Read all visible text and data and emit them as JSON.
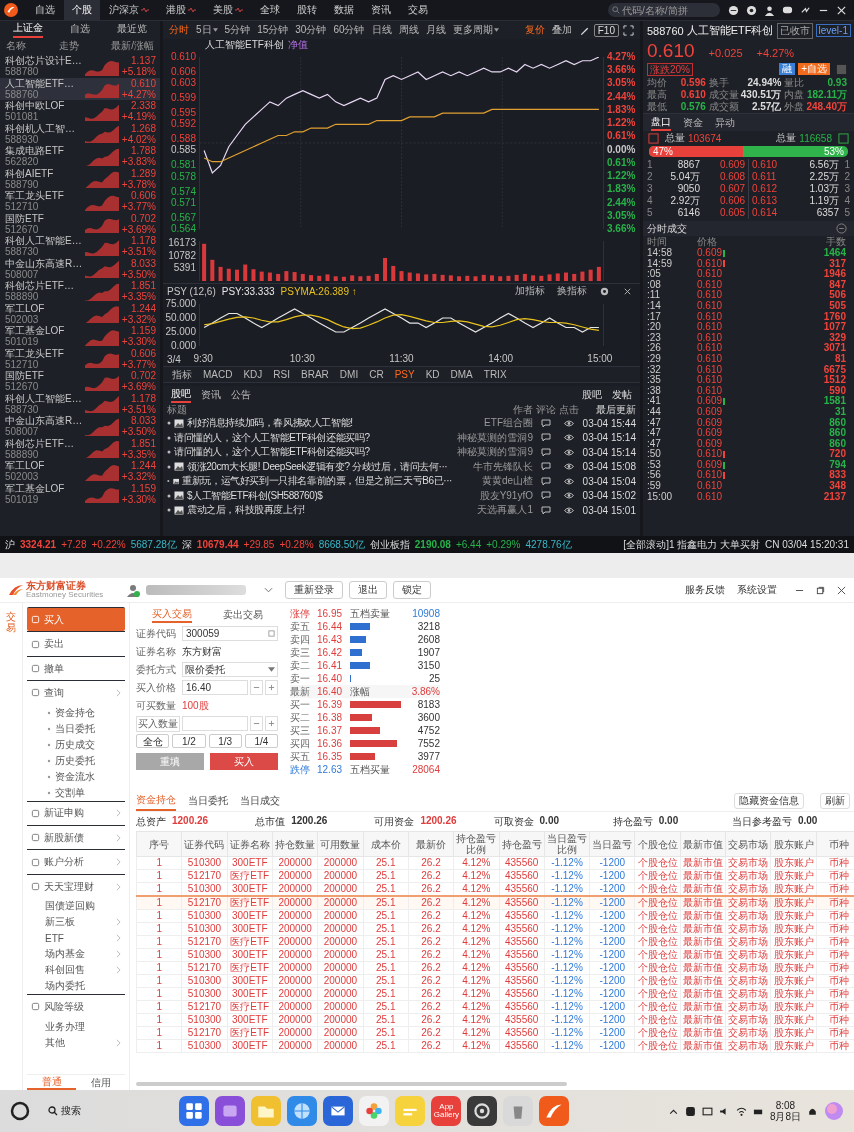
{
  "top_nav": {
    "tabs": [
      {
        "label": "自选",
        "selected": false,
        "live": false
      },
      {
        "label": "个股",
        "selected": true,
        "live": false
      },
      {
        "label": "沪深京",
        "selected": false,
        "live": true
      },
      {
        "label": "港股",
        "selected": false,
        "live": true
      },
      {
        "label": "美股",
        "selected": false,
        "live": true
      },
      {
        "label": "全球",
        "selected": false,
        "live": false
      },
      {
        "label": "股转",
        "selected": false,
        "live": false
      },
      {
        "label": "数据",
        "selected": false,
        "live": false
      },
      {
        "label": "资讯",
        "selected": false,
        "live": false
      },
      {
        "label": "交易",
        "selected": false,
        "live": false
      }
    ],
    "search": {
      "placeholder": "代码/名称/简拼"
    }
  },
  "watchlist": {
    "tabs": [
      {
        "label": "上证金",
        "selected": true
      },
      {
        "label": "自选",
        "selected": false
      },
      {
        "label": "最近览",
        "selected": false
      }
    ],
    "columns": [
      "名称",
      "走势",
      "最新/涨幅"
    ],
    "rows": [
      {
        "name": "科创芯片设计E…",
        "code": "588780",
        "price": "1.137",
        "change": "+5.18%",
        "selected": false
      },
      {
        "name": "人工智能ETF…",
        "code": "588760",
        "price": "0.610",
        "change": "+4.27%",
        "selected": true
      },
      {
        "name": "科创中欧LOF",
        "code": "501081",
        "price": "2.338",
        "change": "+4.19%",
        "selected": false
      },
      {
        "name": "科创机人工智…",
        "code": "588930",
        "price": "1.268",
        "change": "+4.02%",
        "selected": false
      },
      {
        "name": "集成电路ETF",
        "code": "562820",
        "price": "1.788",
        "change": "+3.83%",
        "selected": false
      },
      {
        "name": "科创AIETF",
        "code": "588790",
        "price": "1.289",
        "change": "+3.78%",
        "selected": false
      },
      {
        "name": "军工龙头ETF",
        "code": "512710",
        "price": "0.606",
        "change": "+3.77%",
        "selected": false
      },
      {
        "name": "国防ETF",
        "code": "512670",
        "price": "0.702",
        "change": "+3.69%",
        "selected": false
      },
      {
        "name": "科创人工智能E…",
        "code": "588730",
        "price": "1.178",
        "change": "+3.51%",
        "selected": false
      },
      {
        "name": "中金山东高速R…",
        "code": "508007",
        "price": "8.033",
        "change": "+3.50%",
        "selected": false
      },
      {
        "name": "科创芯片ETF…",
        "code": "588890",
        "price": "1.851",
        "change": "+3.35%",
        "selected": false
      },
      {
        "name": "军工LOF",
        "code": "502003",
        "price": "1.244",
        "change": "+3.32%",
        "selected": false
      },
      {
        "name": "军工基金LOF",
        "code": "501019",
        "price": "1.159",
        "change": "+3.30%",
        "selected": false
      },
      {
        "name": "军工龙头ETF",
        "code": "512710",
        "price": "0.606",
        "change": "+3.77%",
        "selected": false
      },
      {
        "name": "国防ETF",
        "code": "512670",
        "price": "0.702",
        "change": "+3.69%",
        "selected": false
      },
      {
        "name": "科创人工智能E…",
        "code": "588730",
        "price": "1.178",
        "change": "+3.51%",
        "selected": false
      },
      {
        "name": "中金山东高速R…",
        "code": "508007",
        "price": "8.033",
        "change": "+3.50%",
        "selected": false
      },
      {
        "name": "科创芯片ETF…",
        "code": "588890",
        "price": "1.851",
        "change": "+3.35%",
        "selected": false
      },
      {
        "name": "军工LOF",
        "code": "502003",
        "price": "1.244",
        "change": "+3.32%",
        "selected": false
      },
      {
        "name": "军工基金LOF",
        "code": "501019",
        "price": "1.159",
        "change": "+3.30%",
        "selected": false
      }
    ]
  },
  "chart_panel": {
    "periods": [
      {
        "label": "分时",
        "selected": true,
        "menu": false
      },
      {
        "label": "5日",
        "selected": false,
        "menu": true
      },
      {
        "label": "5分钟",
        "selected": false,
        "menu": false
      },
      {
        "label": "15分钟",
        "selected": false,
        "menu": false
      },
      {
        "label": "30分钟",
        "selected": false,
        "menu": false
      },
      {
        "label": "60分钟",
        "selected": false,
        "menu": false
      },
      {
        "label": "日线",
        "selected": false,
        "menu": false
      },
      {
        "label": "周线",
        "selected": false,
        "menu": false
      },
      {
        "label": "月线",
        "selected": false,
        "menu": false
      },
      {
        "label": "更多周期",
        "selected": false,
        "menu": true
      }
    ],
    "price_mode": "复价",
    "overlay": "叠加",
    "f10": "F10",
    "nav_tag": "净值",
    "pct_axis": [
      {
        "text": "4.27%",
        "color": "#f0433b"
      },
      {
        "text": "3.66%",
        "color": "#f0433b"
      },
      {
        "text": "3.05%",
        "color": "#f0433b"
      },
      {
        "text": "2.44%",
        "color": "#f0433b"
      },
      {
        "text": "1.83%",
        "color": "#f0433b"
      },
      {
        "text": "1.22%",
        "color": "#f0433b"
      },
      {
        "text": "0.61%",
        "color": "#f0433b"
      },
      {
        "text": "0.00%",
        "color": "#c8c8c8"
      },
      {
        "text": "0.61%",
        "color": "#27b34a"
      },
      {
        "text": "1.22%",
        "color": "#27b34a"
      },
      {
        "text": "1.83%",
        "color": "#27b34a"
      },
      {
        "text": "2.44%",
        "color": "#27b34a"
      },
      {
        "text": "3.05%",
        "color": "#27b34a"
      },
      {
        "text": "3.66%",
        "color": "#27b34a"
      }
    ],
    "chart_data": {
      "type": "line",
      "title": "人工智能ETF科创",
      "grid": true,
      "categories": [
        null,
        null,
        null,
        null,
        null,
        null,
        null,
        null,
        null,
        null,
        null,
        null,
        null,
        null,
        null,
        null,
        null,
        null,
        null,
        null,
        null,
        null,
        null,
        null,
        null,
        null,
        null,
        null,
        null,
        null,
        null,
        null,
        null,
        null,
        null,
        null,
        null,
        null,
        null,
        null,
        null,
        null,
        null,
        null,
        null,
        null,
        null,
        null,
        null
      ],
      "ylim": [
        0.564,
        0.61
      ],
      "yticks": [
        {
          "value": 0.61,
          "label": "0.610"
        },
        {
          "value": 0.606,
          "label": "0.606"
        },
        {
          "value": 0.603,
          "label": "0.603"
        },
        {
          "value": 0.599,
          "label": "0.599"
        },
        {
          "value": 0.595,
          "label": "0.595"
        },
        {
          "value": 0.592,
          "label": "0.592"
        },
        {
          "value": 0.588,
          "label": "0.588"
        },
        {
          "value": 0.585,
          "label": "0.585"
        },
        {
          "value": 0.581,
          "label": "0.581"
        },
        {
          "value": 0.578,
          "label": "0.578"
        },
        {
          "value": 0.574,
          "label": "0.574"
        },
        {
          "value": 0.571,
          "label": "0.571"
        },
        {
          "value": 0.567,
          "label": "0.567"
        },
        {
          "value": 0.564,
          "label": "0.564"
        }
      ],
      "series": [
        {
          "color": "#e8d8f4",
          "values": [
            0.585,
            0.579,
            0.581,
            0.586,
            0.589,
            0.592,
            0.594,
            0.596,
            0.598,
            0.597,
            0.599,
            0.6,
            0.601,
            0.6,
            0.599,
            0.6,
            0.598,
            0.597,
            0.598,
            0.599,
            0.598,
            0.599,
            0.604,
            0.605,
            0.604,
            0.605,
            0.606,
            0.604,
            0.605,
            0.606,
            0.605,
            0.606,
            0.605,
            0.606,
            0.607,
            0.606,
            0.606,
            0.607,
            0.606,
            0.608,
            0.607,
            0.608,
            0.607,
            0.608,
            0.609,
            0.608,
            0.609,
            0.609,
            0.61
          ]
        },
        {
          "color": "#e0a030",
          "values": [
            0.583,
            0.582,
            0.582,
            0.583,
            0.584,
            0.585,
            0.586,
            0.587,
            0.588,
            0.589,
            0.589,
            0.59,
            0.59,
            0.591,
            0.591,
            0.591,
            0.592,
            0.592,
            0.592,
            0.592,
            0.592,
            0.593,
            0.593,
            0.593,
            0.593,
            0.594,
            0.594,
            0.594,
            0.594,
            0.595,
            0.595,
            0.595,
            0.595,
            0.595,
            0.595,
            0.596,
            0.596,
            0.596,
            0.596,
            0.596,
            0.596,
            0.596,
            0.596,
            0.596,
            0.596,
            0.596,
            0.596,
            0.596,
            0.596
          ]
        }
      ]
    },
    "volume": {
      "chart_data": {
        "type": "bar",
        "categories": [
          null,
          null,
          null,
          null,
          null,
          null,
          null,
          null,
          null,
          null,
          null,
          null,
          null,
          null,
          null,
          null,
          null,
          null,
          null,
          null,
          null,
          null,
          null,
          null,
          null,
          null,
          null,
          null,
          null,
          null,
          null,
          null,
          null,
          null,
          null,
          null,
          null,
          null,
          null,
          null,
          null,
          null,
          null,
          null,
          null,
          null,
          null,
          null,
          null
        ],
        "ylim": [
          0,
          17000
        ],
        "yticks": [
          16173,
          10782,
          5391
        ],
        "series": [
          {
            "color": "#d9393a",
            "values": [
              15800,
              9000,
              6000,
              5200,
              4800,
              7000,
              5000,
              4000,
              3600,
              3000,
              4200,
              3800,
              3000,
              2500,
              2200,
              2800,
              2000,
              1800,
              2400,
              2000,
              2200,
              3000,
              9800,
              6400,
              4200,
              3600,
              3200,
              2800,
              3000,
              2600,
              2400,
              2000,
              2200,
              2000,
              2600,
              2400,
              2000,
              2200,
              2600,
              3000,
              2400,
              2200,
              2800,
              3200,
              3600,
              3000,
              4000,
              4800,
              6000
            ]
          }
        ]
      }
    },
    "indicator": {
      "name": "PSY (12,6)",
      "readouts": [
        {
          "text": "PSY:33.333",
          "color": "#e6e6e6"
        },
        {
          "text": "PSYMA:26.389 ↑",
          "color": "#e8c21e"
        }
      ],
      "buttons": [
        "加指标",
        "换指标"
      ],
      "chart_data": {
        "type": "line",
        "ylim": [
          0,
          75
        ],
        "yticks": [
          {
            "value": 75,
            "label": "75.000"
          },
          {
            "value": 50,
            "label": "50.000"
          },
          {
            "value": 25,
            "label": "25.000"
          },
          {
            "value": 0,
            "label": "0.000"
          }
        ],
        "categories": [
          "9:30",
          null,
          null,
          null,
          null,
          null,
          null,
          null,
          null,
          null,
          null,
          null,
          "10:30",
          null,
          null,
          null,
          null,
          null,
          null,
          null,
          null,
          null,
          null,
          null,
          "11:30",
          null,
          null,
          null,
          null,
          null,
          null,
          null,
          null,
          null,
          null,
          null,
          "14:00",
          null,
          null,
          null,
          null,
          null,
          null,
          null,
          null,
          null,
          null,
          null,
          "15:00"
        ],
        "series": [
          {
            "color": "#e6e6e6",
            "values": [
              33,
              41,
              50,
              58,
              58,
              50,
              41,
              33,
              41,
              50,
              58,
              66,
              58,
              50,
              41,
              33,
              25,
              25,
              33,
              41,
              50,
              58,
              66,
              58,
              50,
              41,
              41,
              33,
              41,
              50,
              50,
              41,
              33,
              25,
              33,
              41,
              50,
              58,
              50,
              41,
              33,
              41,
              50,
              41,
              33,
              33,
              25,
              33,
              33
            ]
          },
          {
            "color": "#e8c21e",
            "values": [
              38,
              40,
              44,
              48,
              51,
              52,
              50,
              46,
              43,
              43,
              47,
              52,
              55,
              55,
              52,
              47,
              40,
              34,
              31,
              32,
              37,
              43,
              50,
              55,
              56,
              53,
              49,
              45,
              42,
              42,
              44,
              45,
              43,
              39,
              35,
              34,
              37,
              42,
              47,
              49,
              47,
              44,
              42,
              42,
              41,
              38,
              34,
              30,
              28
            ]
          }
        ]
      }
    },
    "date_label": "3/4",
    "indicator_tabs": [
      {
        "label": "指标",
        "selected": false
      },
      {
        "label": "MACD",
        "selected": false
      },
      {
        "label": "KDJ",
        "selected": false
      },
      {
        "label": "RSI",
        "selected": false
      },
      {
        "label": "BRAR",
        "selected": false
      },
      {
        "label": "DMI",
        "selected": false
      },
      {
        "label": "CR",
        "selected": false
      },
      {
        "label": "PSY",
        "selected": true
      },
      {
        "label": "KD",
        "selected": false
      },
      {
        "label": "DMA",
        "selected": false
      },
      {
        "label": "TRIX",
        "selected": false
      }
    ]
  },
  "news": {
    "tabs": [
      {
        "label": "股吧",
        "selected": true
      },
      {
        "label": "资讯",
        "selected": false
      },
      {
        "label": "公告",
        "selected": false
      }
    ],
    "actions": [
      "股吧",
      "发帖"
    ],
    "columns": [
      "标题",
      "作者",
      "评论",
      "点击",
      "最后更新"
    ],
    "rows": [
      {
        "title": "利好消息持续加码，春风拂欢人工智能!",
        "author": "ETF组合圈",
        "time": "03-04 15:44",
        "has_image": true
      },
      {
        "title": "请问懂的人，这个人工智能ETF科创还能买吗?",
        "author": "神秘莫测的雪洞9",
        "time": "03-04 15:14",
        "has_image": false
      },
      {
        "title": "请问懂的人，这个人工智能ETF科创还能买吗?",
        "author": "神秘莫测的雪洞9",
        "time": "03-04 15:14",
        "has_image": false
      },
      {
        "title": "领涨20cm大长腿! DeepSeek逻辑有变? 分歧过后，请问去何···",
        "author": "牛市先锋队长",
        "time": "03-04 15:08",
        "has_image": true
      },
      {
        "title": "重新玩，运气好买到一只排名靠前的票，但是之前三天亏B6已···",
        "author": "黄黄de山楂",
        "time": "03-04 15:04",
        "has_image": true
      },
      {
        "title": "$人工智能ETF科创(SH588760)$",
        "author": "股友Y91yfO",
        "time": "03-04 15:02",
        "has_image": true
      },
      {
        "title": "震动之后，科技股再度上行!",
        "author": "天选再赢人1",
        "time": "03-04 15:01",
        "has_image": true
      }
    ]
  },
  "quote": {
    "code": "588760",
    "name": "人工智能ETF科创",
    "status": "已收市",
    "level": "level-1",
    "price": "0.610",
    "change": "+0.025",
    "pct": "+4.27%",
    "limit_tag": "涨跌20%",
    "tags": [
      {
        "label": "融",
        "color": "#3a7fd5"
      },
      {
        "label": "+自选",
        "color": "#f26b1d"
      }
    ],
    "stats": [
      {
        "label": "均价",
        "value": "0.596",
        "color": "#f0433b"
      },
      {
        "label": "换手",
        "value": "24.94%",
        "color": "#dddddd"
      },
      {
        "label": "量比",
        "value": "0.93",
        "color": "#27b34a"
      },
      {
        "label": "最高",
        "value": "0.610",
        "color": "#f0433b"
      },
      {
        "label": "成交量",
        "value": "430.51万",
        "color": "#dddddd"
      },
      {
        "label": "内盘",
        "value": "182.11万",
        "color": "#27b34a"
      },
      {
        "label": "最低",
        "value": "0.576",
        "color": "#27b34a"
      },
      {
        "label": "成交额",
        "value": "2.57亿",
        "color": "#dddddd"
      },
      {
        "label": "外盘",
        "value": "248.40万",
        "color": "#f0433b"
      }
    ],
    "tabs": [
      {
        "label": "盘口",
        "selected": true
      },
      {
        "label": "资金",
        "selected": false
      },
      {
        "label": "异动",
        "selected": false
      }
    ],
    "bid_total": {
      "label": "总量",
      "value": "103674"
    },
    "ask_total": {
      "label": "总量",
      "value": "116658"
    },
    "ratio": {
      "buy_text": "47%",
      "sell_text": "53%",
      "level": 0.47
    },
    "book": [
      {
        "bid_level": "1",
        "bid_vol": "8867",
        "bid_price": "0.609",
        "ask_price": "0.610",
        "ask_vol": "6.56万",
        "ask_level": "1"
      },
      {
        "bid_level": "2",
        "bid_vol": "5.04万",
        "bid_price": "0.608",
        "ask_price": "0.611",
        "ask_vol": "2.25万",
        "ask_level": "2"
      },
      {
        "bid_level": "3",
        "bid_vol": "9050",
        "bid_price": "0.607",
        "ask_price": "0.612",
        "ask_vol": "1.03万",
        "ask_level": "3"
      },
      {
        "bid_level": "4",
        "bid_vol": "2.92万",
        "bid_price": "0.606",
        "ask_price": "0.613",
        "ask_vol": "1.19万",
        "ask_level": "4"
      },
      {
        "bid_level": "5",
        "bid_vol": "6146",
        "bid_price": "0.605",
        "ask_price": "0.614",
        "ask_vol": "6357",
        "ask_level": "5"
      }
    ],
    "trades_title": "分时成交",
    "trade_columns": [
      "时间",
      "价格",
      "手数"
    ],
    "trades": [
      {
        "time": "14:58",
        "price": "0.609",
        "volume": "1464",
        "color": "#27b34a",
        "marker": true
      },
      {
        "time": "14:59",
        "price": "0.610",
        "volume": "317",
        "color": "#f0433b",
        "marker": true
      },
      {
        "time": ":05",
        "price": "0.610",
        "volume": "1946",
        "color": "#f0433b",
        "marker": false
      },
      {
        "time": ":08",
        "price": "0.610",
        "volume": "847",
        "color": "#f0433b",
        "marker": false
      },
      {
        "time": ":11",
        "price": "0.610",
        "volume": "506",
        "color": "#f0433b",
        "marker": false
      },
      {
        "time": ":14",
        "price": "0.610",
        "volume": "505",
        "color": "#f0433b",
        "marker": false
      },
      {
        "time": ":17",
        "price": "0.610",
        "volume": "1760",
        "color": "#f0433b",
        "marker": false
      },
      {
        "time": ":20",
        "price": "0.610",
        "volume": "1077",
        "color": "#f0433b",
        "marker": false
      },
      {
        "time": ":23",
        "price": "0.610",
        "volume": "329",
        "color": "#f0433b",
        "marker": false
      },
      {
        "time": ":26",
        "price": "0.610",
        "volume": "3071",
        "color": "#f0433b",
        "marker": false
      },
      {
        "time": ":29",
        "price": "0.610",
        "volume": "81",
        "color": "#f0433b",
        "marker": false
      },
      {
        "time": ":32",
        "price": "0.610",
        "volume": "6675",
        "color": "#f0433b",
        "marker": false
      },
      {
        "time": ":35",
        "price": "0.610",
        "volume": "1512",
        "color": "#f0433b",
        "marker": false
      },
      {
        "time": ":38",
        "price": "0.610",
        "volume": "590",
        "color": "#f0433b",
        "marker": false
      },
      {
        "time": ":41",
        "price": "0.609",
        "volume": "1581",
        "color": "#27b34a",
        "marker": true
      },
      {
        "time": ":44",
        "price": "0.609",
        "volume": "31",
        "color": "#27b34a",
        "marker": false
      },
      {
        "time": ":47",
        "price": "0.609",
        "volume": "860",
        "color": "#27b34a",
        "marker": false
      },
      {
        "time": ":47",
        "price": "0.609",
        "volume": "860",
        "color": "#27b34a",
        "marker": false
      },
      {
        "time": ":47",
        "price": "0.609",
        "volume": "860",
        "color": "#27b34a",
        "marker": false
      },
      {
        "time": ":50",
        "price": "0.610",
        "volume": "720",
        "color": "#f0433b",
        "marker": true
      },
      {
        "time": ":53",
        "price": "0.609",
        "volume": "794",
        "color": "#27b34a",
        "marker": true
      },
      {
        "time": ":56",
        "price": "0.610",
        "volume": "833",
        "color": "#f0433b",
        "marker": true
      },
      {
        "time": ":59",
        "price": "0.610",
        "volume": "348",
        "color": "#f0433b",
        "marker": false
      },
      {
        "time": "15:00",
        "price": "0.610",
        "volume": "2137",
        "color": "#f0433b",
        "marker": false
      }
    ]
  },
  "status_bar": {
    "indices": [
      {
        "market": "沪",
        "value": "3324.21",
        "change": "+7.28",
        "pct": "+0.22%",
        "turnover": "5687.28亿",
        "color": "#f0433b"
      },
      {
        "market": "深",
        "value": "10679.44",
        "change": "+29.85",
        "pct": "+0.28%",
        "turnover": "8668.50亿",
        "color": "#f0433b"
      },
      {
        "market": "创业板指",
        "value": "2190.08",
        "change": "+6.44",
        "pct": "+0.29%",
        "turnover": "4278.76亿",
        "color": "#27b34a"
      }
    ],
    "ticker": "[全部滚动]1 指鑫电力 大单买射",
    "clock": "CN 03/04 15:20:31"
  },
  "trading": {
    "brand": "东方财富证券",
    "brand_en": "Eastmoney Securities",
    "header_buttons": [
      "重新登录",
      "退出",
      "锁定"
    ],
    "header_links": [
      "服务反馈",
      "系统设置"
    ],
    "side_tab": "交易",
    "menu": [
      {
        "label": "买入",
        "kind": "main",
        "selected": true,
        "expandable": false
      },
      {
        "label": "卖出",
        "kind": "main",
        "selected": false,
        "expandable": false
      },
      {
        "label": "撤单",
        "kind": "main",
        "selected": false,
        "expandable": false
      },
      {
        "label": "查询",
        "kind": "main",
        "selected": false,
        "expandable": true
      },
      {
        "label": "资金持仓",
        "kind": "sub",
        "selected": false,
        "expandable": false
      },
      {
        "label": "当日委托",
        "kind": "sub",
        "selected": false,
        "expandable": false
      },
      {
        "label": "历史成交",
        "kind": "sub",
        "selected": false,
        "expandable": false
      },
      {
        "label": "历史委托",
        "kind": "sub",
        "selected": false,
        "expandable": false
      },
      {
        "label": "资金流水",
        "kind": "sub",
        "selected": false,
        "expandable": false
      },
      {
        "label": "交割单",
        "kind": "sub",
        "selected": false,
        "expandable": false
      },
      {
        "label": "新证申购",
        "kind": "main",
        "selected": false,
        "expandable": true
      },
      {
        "label": "新股新债",
        "kind": "main",
        "selected": false,
        "expandable": true
      },
      {
        "label": "账户分析",
        "kind": "main",
        "selected": false,
        "expandable": true
      },
      {
        "label": "天天宝理财",
        "kind": "main",
        "selected": false,
        "expandable": true
      },
      {
        "label": "国债逆回购",
        "kind": "plain",
        "selected": false,
        "expandable": false
      },
      {
        "label": "新三板",
        "kind": "plain",
        "selected": false,
        "expandable": true
      },
      {
        "label": "ETF",
        "kind": "plain",
        "selected": false,
        "expandable": true
      },
      {
        "label": "场内基金",
        "kind": "plain",
        "selected": false,
        "expandable": true
      },
      {
        "label": "科创回售",
        "kind": "plain",
        "selected": false,
        "expandable": true
      },
      {
        "label": "场内委托",
        "kind": "plain",
        "selected": false,
        "expandable": false
      },
      {
        "label": "风险等级",
        "kind": "main",
        "selected": false,
        "expandable": false
      },
      {
        "label": "业务办理",
        "kind": "plain",
        "selected": false,
        "expandable": false
      },
      {
        "label": "其他",
        "kind": "plain",
        "selected": false,
        "expandable": true
      }
    ],
    "account_tabs": [
      {
        "label": "普通",
        "selected": true
      },
      {
        "label": "信用",
        "selected": false
      }
    ],
    "form": {
      "tabs": [
        {
          "label": "买入交易",
          "selected": true
        },
        {
          "label": "卖出交易",
          "selected": false
        }
      ],
      "code_label": "证券代码",
      "code": "300059",
      "name_label": "证券名称",
      "name": "东方财富",
      "type_label": "委托方式",
      "order_type": "限价委托",
      "price_label": "买入价格",
      "price": "16.40",
      "avail_label": "可买数量",
      "available": "100股",
      "qty_label": "买入数量",
      "quick": [
        "全仓",
        "1/2",
        "1/3",
        "1/4"
      ],
      "reset": "重填",
      "submit": "买入"
    },
    "book": [
      {
        "label": "涨停",
        "price": "16.95",
        "note": "五档卖量",
        "volume": "10908",
        "kind": "limit_up"
      },
      {
        "label": "卖五",
        "price": "16.44",
        "volume": "3218",
        "kind": "ask"
      },
      {
        "label": "卖四",
        "price": "16.43",
        "volume": "2608",
        "kind": "ask"
      },
      {
        "label": "卖三",
        "price": "16.42",
        "volume": "1907",
        "kind": "ask"
      },
      {
        "label": "卖二",
        "price": "16.41",
        "volume": "3150",
        "kind": "ask"
      },
      {
        "label": "卖一",
        "price": "16.40",
        "volume": "25",
        "kind": "ask"
      },
      {
        "label": "最新",
        "price": "16.40",
        "note": "涨幅",
        "volume": "3.86%",
        "kind": "last"
      },
      {
        "label": "买一",
        "price": "16.39",
        "volume": "8183",
        "kind": "bid"
      },
      {
        "label": "买二",
        "price": "16.38",
        "volume": "3600",
        "kind": "bid"
      },
      {
        "label": "买三",
        "price": "16.37",
        "volume": "4752",
        "kind": "bid"
      },
      {
        "label": "买四",
        "price": "16.36",
        "volume": "7552",
        "kind": "bid"
      },
      {
        "label": "买五",
        "price": "16.35",
        "volume": "3977",
        "kind": "bid"
      },
      {
        "label": "跌停",
        "price": "12.63",
        "note": "五档买量",
        "volume": "28064",
        "kind": "limit_down"
      }
    ],
    "positions": {
      "tabs": [
        {
          "label": "资金持仓",
          "selected": true
        },
        {
          "label": "当日委托",
          "selected": false
        },
        {
          "label": "当日成交",
          "selected": false
        }
      ],
      "actions": [
        "隐藏资金信息",
        "刷新"
      ],
      "summary": [
        {
          "label": "总资产",
          "value": "1200.26",
          "color": "#e03c3c"
        },
        {
          "label": "总市值",
          "value": "1200.26",
          "color": "#333333"
        },
        {
          "label": "可用资金",
          "value": "1200.26",
          "color": "#e03c3c"
        },
        {
          "label": "可取资金",
          "value": "0.00",
          "color": "#333333"
        },
        {
          "label": "持仓盈亏",
          "value": "0.00",
          "color": "#333333"
        },
        {
          "label": "当日参考盈亏",
          "value": "0.00",
          "color": "#333333"
        }
      ],
      "columns": [
        "序号",
        "证券代码",
        "证券名称",
        "持仓数量",
        "可用数量",
        "成本价",
        "最新价",
        "持仓盈亏比例",
        "持仓盈亏",
        "当日盈亏比例",
        "当日盈亏",
        "个股仓位",
        "最新市值",
        "交易市场",
        "股东账户",
        "币种"
      ],
      "rows": [
        {
          "cells": [
            "1",
            "510300",
            "300ETF",
            "200000",
            "200000",
            "25.1",
            "26.2",
            "4.12%",
            "435560",
            "-1.12%",
            "-1200",
            "个股仓位",
            "最新市值",
            "交易市场",
            "股东账户",
            "币种"
          ],
          "selected": false
        },
        {
          "cells": [
            "1",
            "512170",
            "医疗ETF",
            "200000",
            "200000",
            "25.1",
            "26.2",
            "4.12%",
            "435560",
            "-1.12%",
            "-1200",
            "个股仓位",
            "最新市值",
            "交易市场",
            "股东账户",
            "币种"
          ],
          "selected": false
        },
        {
          "cells": [
            "1",
            "510300",
            "300ETF",
            "200000",
            "200000",
            "25.1",
            "26.2",
            "4.12%",
            "435560",
            "-1.12%",
            "-1200",
            "个股仓位",
            "最新市值",
            "交易市场",
            "股东账户",
            "币种"
          ],
          "selected": false
        },
        {
          "cells": [
            "1",
            "512170",
            "医疗ETF",
            "200000",
            "200000",
            "25.1",
            "26.2",
            "4.12%",
            "435560",
            "-1.12%",
            "-1200",
            "个股仓位",
            "最新市值",
            "交易市场",
            "股东账户",
            "币种"
          ],
          "selected": true
        },
        {
          "cells": [
            "1",
            "510300",
            "300ETF",
            "200000",
            "200000",
            "25.1",
            "26.2",
            "4.12%",
            "435560",
            "-1.12%",
            "-1200",
            "个股仓位",
            "最新市值",
            "交易市场",
            "股东账户",
            "币种"
          ],
          "selected": false
        },
        {
          "cells": [
            "1",
            "510300",
            "300ETF",
            "200000",
            "200000",
            "25.1",
            "26.2",
            "4.12%",
            "435560",
            "-1.12%",
            "-1200",
            "个股仓位",
            "最新市值",
            "交易市场",
            "股东账户",
            "币种"
          ],
          "selected": false
        },
        {
          "cells": [
            "1",
            "512170",
            "医疗ETF",
            "200000",
            "200000",
            "25.1",
            "26.2",
            "4.12%",
            "435560",
            "-1.12%",
            "-1200",
            "个股仓位",
            "最新市值",
            "交易市场",
            "股东账户",
            "币种"
          ],
          "selected": false
        },
        {
          "cells": [
            "1",
            "510300",
            "300ETF",
            "200000",
            "200000",
            "25.1",
            "26.2",
            "4.12%",
            "435560",
            "-1.12%",
            "-1200",
            "个股仓位",
            "最新市值",
            "交易市场",
            "股东账户",
            "币种"
          ],
          "selected": false
        },
        {
          "cells": [
            "1",
            "512170",
            "医疗ETF",
            "200000",
            "200000",
            "25.1",
            "26.2",
            "4.12%",
            "435560",
            "-1.12%",
            "-1200",
            "个股仓位",
            "最新市值",
            "交易市场",
            "股东账户",
            "币种"
          ],
          "selected": false
        },
        {
          "cells": [
            "1",
            "510300",
            "300ETF",
            "200000",
            "200000",
            "25.1",
            "26.2",
            "4.12%",
            "435560",
            "-1.12%",
            "-1200",
            "个股仓位",
            "最新市值",
            "交易市场",
            "股东账户",
            "币种"
          ],
          "selected": false
        },
        {
          "cells": [
            "1",
            "510300",
            "300ETF",
            "200000",
            "200000",
            "25.1",
            "26.2",
            "4.12%",
            "435560",
            "-1.12%",
            "-1200",
            "个股仓位",
            "最新市值",
            "交易市场",
            "股东账户",
            "币种"
          ],
          "selected": false
        },
        {
          "cells": [
            "1",
            "512170",
            "医疗ETF",
            "200000",
            "200000",
            "25.1",
            "26.2",
            "4.12%",
            "435560",
            "-1.12%",
            "-1200",
            "个股仓位",
            "最新市值",
            "交易市场",
            "股东账户",
            "币种"
          ],
          "selected": false
        },
        {
          "cells": [
            "1",
            "510300",
            "300ETF",
            "200000",
            "200000",
            "25.1",
            "26.2",
            "4.12%",
            "435560",
            "-1.12%",
            "-1200",
            "个股仓位",
            "最新市值",
            "交易市场",
            "股东账户",
            "币种"
          ],
          "selected": false
        },
        {
          "cells": [
            "1",
            "512170",
            "医疗ETF",
            "200000",
            "200000",
            "25.1",
            "26.2",
            "4.12%",
            "435560",
            "-1.12%",
            "-1200",
            "个股仓位",
            "最新市值",
            "交易市场",
            "股东账户",
            "币种"
          ],
          "selected": false
        },
        {
          "cells": [
            "1",
            "510300",
            "300ETF",
            "200000",
            "200000",
            "25.1",
            "26.2",
            "4.12%",
            "435560",
            "-1.12%",
            "-1200",
            "个股仓位",
            "最新市值",
            "交易市场",
            "股东账户",
            "币种"
          ],
          "selected": false
        }
      ]
    }
  },
  "taskbar": {
    "search": "搜索",
    "apps": [
      {
        "kind": "grid"
      },
      {
        "kind": "windows"
      },
      {
        "kind": "folder"
      },
      {
        "kind": "browser"
      },
      {
        "kind": "mail"
      },
      {
        "kind": "photos"
      },
      {
        "kind": "notes"
      },
      {
        "kind": "gallery",
        "label": "App Gallery"
      },
      {
        "kind": "settings"
      },
      {
        "kind": "trash"
      },
      {
        "kind": "eastmoney"
      }
    ],
    "time": "8:08",
    "date": "8月8日"
  }
}
